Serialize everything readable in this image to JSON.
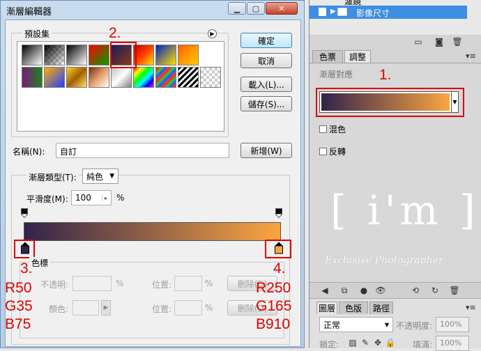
{
  "dialog": {
    "title": "漸層編輯器",
    "presets_label": "預設集",
    "ok_label": "確定",
    "cancel_label": "取消",
    "load_label": "載入(L)...",
    "save_label": "儲存(S)...",
    "name_label": "名稱(N):",
    "name_value": "自訂",
    "new_label": "新增(W)",
    "gradient_type_label": "漸層類型(T):",
    "gradient_type_value": "純色",
    "smoothness_label": "平滑度(M):",
    "smoothness_value": "100",
    "smoothness_unit": "%",
    "stops_label": "色標",
    "opacity_label": "不透明:",
    "pct": "%",
    "location_label": "位置:",
    "delete_label": "刪除(D)",
    "color_label": "顏色:",
    "gradient_start_color": "#32234b",
    "gradient_end_color": "#faa541"
  },
  "annotations": {
    "a1": "1.",
    "a2": "2.",
    "a3": "3.",
    "a4": "4.",
    "left_r": "R50",
    "left_g": "G35",
    "left_b": "B75",
    "right_r": "R250",
    "right_g": "G165",
    "right_b": "B910"
  },
  "panel": {
    "layer_name": "影像尺寸",
    "layer_name_partial": "濾鏡",
    "tab_swatches": "色票",
    "tab_adjustments": "調整",
    "adjust_title": "漸層對應",
    "dither_label": "混色",
    "reverse_label": "反轉",
    "watermark_brand": "[ i'm ]",
    "watermark_text": "Exclusive Photographer",
    "tab_layers": "圖層",
    "tab_channels": "色版",
    "tab_paths": "路徑",
    "blend_mode": "正常",
    "opacity_label": "不透明度:",
    "opacity_value": "100%",
    "lock_label": "鎖定:",
    "fill_label": "填滿:",
    "fill_value": "100%"
  }
}
